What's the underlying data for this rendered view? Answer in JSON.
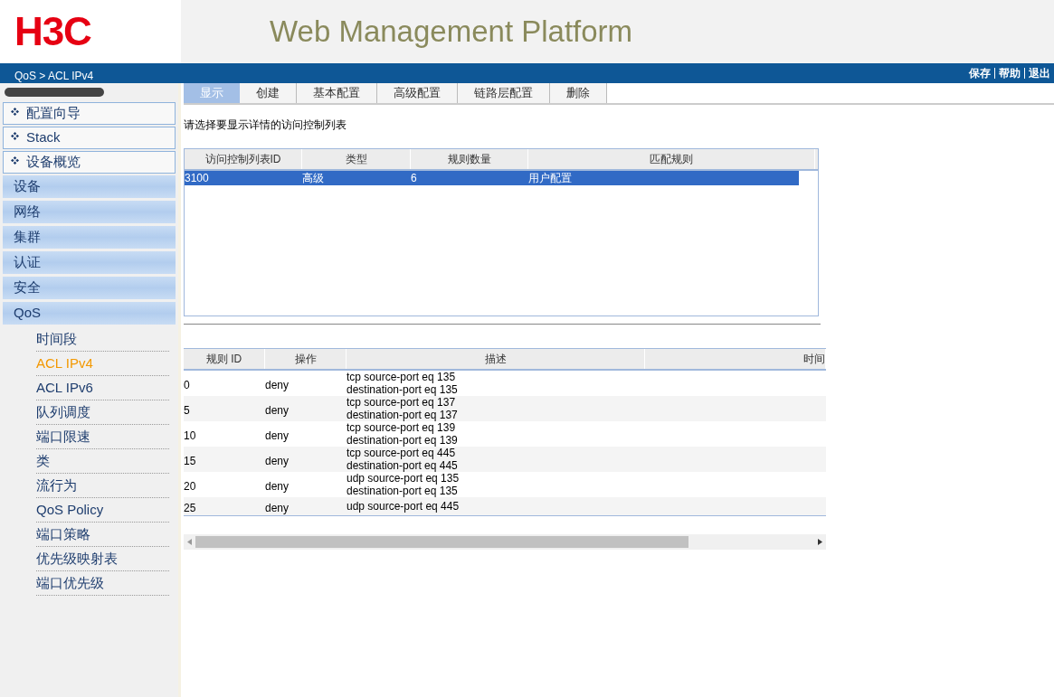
{
  "header": {
    "logo": "H3C",
    "title": "Web Management Platform"
  },
  "nav_bar": {
    "breadcrumb": "QoS > ACL IPv4",
    "links": [
      "保存",
      "帮助",
      "退出"
    ]
  },
  "sidebar": {
    "items": [
      {
        "kind": "link",
        "label": "配置向导",
        "selected": false
      },
      {
        "kind": "link",
        "label": "Stack",
        "selected": false
      },
      {
        "kind": "link",
        "label": "设备概览",
        "selected": false
      },
      {
        "kind": "category",
        "label": "设备",
        "selected": false
      },
      {
        "kind": "category",
        "label": "网络",
        "selected": false
      },
      {
        "kind": "category",
        "label": "集群",
        "selected": false
      },
      {
        "kind": "category",
        "label": "认证",
        "selected": false
      },
      {
        "kind": "category",
        "label": "安全",
        "selected": false
      },
      {
        "kind": "category",
        "label": "QoS",
        "selected": false
      },
      {
        "kind": "sub",
        "label": "时间段",
        "selected": false
      },
      {
        "kind": "sub",
        "label": "ACL IPv4",
        "selected": true
      },
      {
        "kind": "sub",
        "label": "ACL IPv6",
        "selected": false
      },
      {
        "kind": "sub",
        "label": "队列调度",
        "selected": false
      },
      {
        "kind": "sub",
        "label": "端口限速",
        "selected": false
      },
      {
        "kind": "sub",
        "label": "类",
        "selected": false
      },
      {
        "kind": "sub",
        "label": "流行为",
        "selected": false
      },
      {
        "kind": "sub",
        "label": "QoS Policy",
        "selected": false
      },
      {
        "kind": "sub",
        "label": "端口策略",
        "selected": false
      },
      {
        "kind": "sub",
        "label": "优先级映射表",
        "selected": false
      },
      {
        "kind": "sub",
        "label": "端口优先级",
        "selected": false
      }
    ]
  },
  "tabs": [
    {
      "label": "显示",
      "selected": true
    },
    {
      "label": "创建",
      "selected": false
    },
    {
      "label": "基本配置",
      "selected": false
    },
    {
      "label": "高级配置",
      "selected": false
    },
    {
      "label": "链路层配置",
      "selected": false
    },
    {
      "label": "删除",
      "selected": false
    }
  ],
  "prompt": "请选择要显示详情的访问控制列表",
  "acl_table": {
    "columns": [
      "访问控制列表ID",
      "类型",
      "规则数量",
      "匹配规则"
    ],
    "rows": [
      {
        "cells": [
          "3100",
          "高级",
          "6",
          "用户配置"
        ],
        "selected": true
      }
    ]
  },
  "rule_table": {
    "columns": [
      "规则 ID",
      "操作",
      "描述",
      "时间"
    ],
    "rows": [
      {
        "cells": [
          "0",
          "deny",
          "tcp source-port eq 135\ndestination-port eq 135",
          ""
        ]
      },
      {
        "cells": [
          "5",
          "deny",
          "tcp source-port eq 137\ndestination-port eq 137",
          ""
        ]
      },
      {
        "cells": [
          "10",
          "deny",
          "tcp source-port eq 139\ndestination-port eq 139",
          ""
        ]
      },
      {
        "cells": [
          "15",
          "deny",
          "tcp source-port eq 445\ndestination-port eq 445",
          ""
        ]
      },
      {
        "cells": [
          "20",
          "deny",
          "udp source-port eq 135\ndestination-port eq 135",
          ""
        ]
      },
      {
        "cells": [
          "25",
          "deny",
          "udp source-port eq 445",
          ""
        ]
      }
    ]
  }
}
